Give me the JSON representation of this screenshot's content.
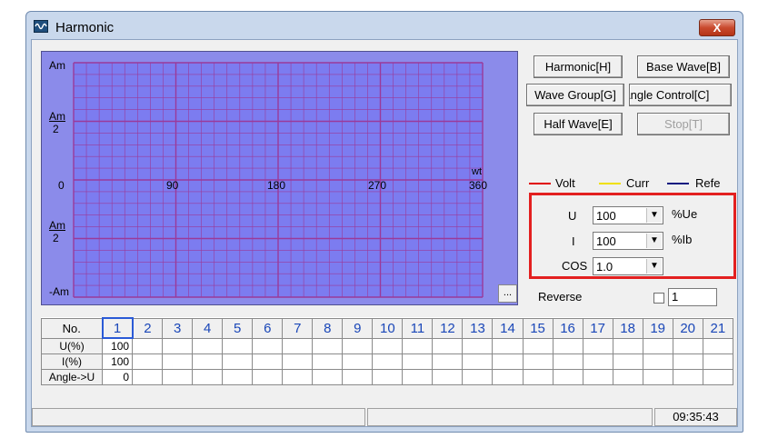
{
  "window": {
    "title": "Harmonic",
    "close_label": "X"
  },
  "chart": {
    "y_labels": [
      "Am",
      "Am",
      "2",
      "0",
      "Am",
      "2",
      "-Am"
    ],
    "x_labels": [
      "90",
      "180",
      "270",
      "360"
    ],
    "x_unit": "wt",
    "more_button": "..."
  },
  "chart_data": {
    "type": "line",
    "x_ticks": [
      0,
      90,
      180,
      270,
      360
    ],
    "xlim": [
      0,
      360
    ],
    "y_ticks": [
      "Am",
      "Am/2",
      "0",
      "-Am/2",
      "-Am"
    ],
    "xlabel": "wt",
    "grid": true,
    "series": []
  },
  "buttons": {
    "harmonic": "Harmonic[H]",
    "base_wave": "Base Wave[B]",
    "wave_group": "Wave Group[G]",
    "angle_control": "Angle Control[C]",
    "half_wave": "Half Wave[E]",
    "stop": "Stop[T]"
  },
  "legend": {
    "volt": "Volt",
    "curr": "Curr",
    "refe": "Refe",
    "volt_color": "#e00000",
    "curr_color": "#f0e000",
    "refe_color": "#0a1a80"
  },
  "params": {
    "u_label": "U",
    "u_value": "100",
    "u_unit": "%Ue",
    "i_label": "I",
    "i_value": "100",
    "i_unit": "%Ib",
    "cos_label": "COS",
    "cos_value": "1.0",
    "dropdown_arrow": "▼"
  },
  "reverse": {
    "label": "Reverse",
    "value": "1"
  },
  "table": {
    "columns": [
      "No.",
      "1",
      "2",
      "3",
      "4",
      "5",
      "6",
      "7",
      "8",
      "9",
      "10",
      "11",
      "12",
      "13",
      "14",
      "15",
      "16",
      "17",
      "18",
      "19",
      "20",
      "21"
    ],
    "rows": [
      {
        "label": "U(%)",
        "values": [
          "100"
        ]
      },
      {
        "label": "I(%)",
        "values": [
          "100"
        ]
      },
      {
        "label": "Angle->U",
        "values": [
          "0"
        ]
      }
    ]
  },
  "status": {
    "time": "09:35:43"
  }
}
